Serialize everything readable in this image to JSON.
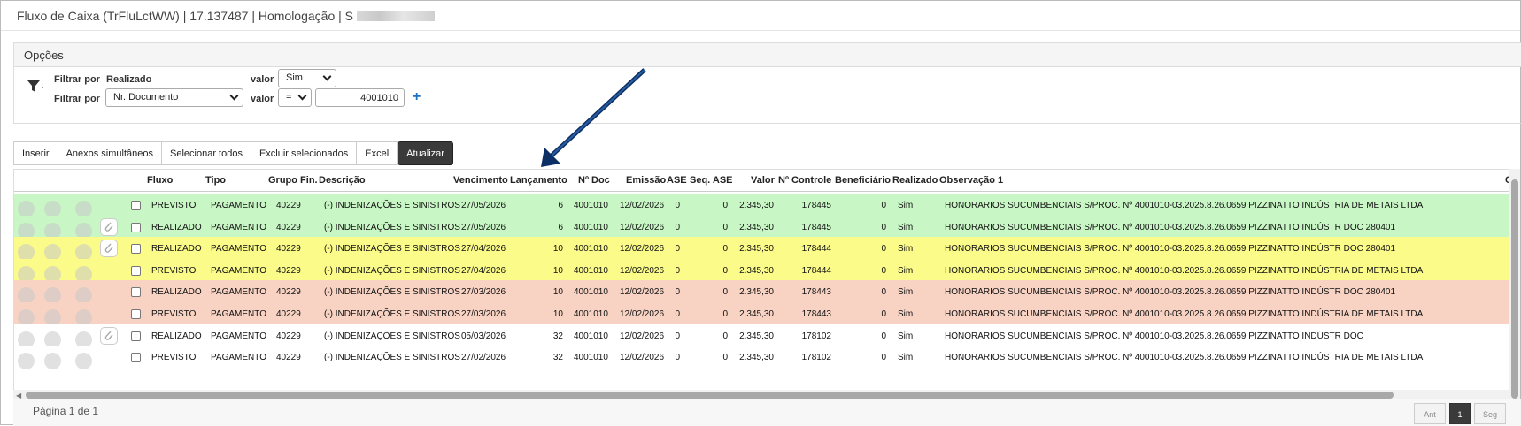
{
  "window": {
    "title": "Fluxo de Caixa (TrFluLctWW) | 17.137487 | Homologação | S"
  },
  "options": {
    "header": "Opções",
    "filters": [
      {
        "label": "Filtrar por",
        "field": "Realizado",
        "value_label": "valor",
        "value": "Sim"
      },
      {
        "label": "Filtrar por",
        "field": "Nr. Documento",
        "value_label": "valor",
        "operator": "=",
        "value": "4001010"
      }
    ],
    "add_filter_icon": "plus-icon"
  },
  "toolbar": {
    "insert": "Inserir",
    "annexes": "Anexos simultâneos",
    "select_all": "Selecionar todos",
    "delete_selected": "Excluir selecionados",
    "excel": "Excel",
    "refresh": "Atualizar"
  },
  "grid": {
    "columns": [
      "Fluxo",
      "Tipo",
      "Grupo Fin.",
      "Descrição",
      "Vencimento",
      "Lançamento",
      "Nº Doc",
      "Emissão",
      "ASE",
      "Seq. ASE",
      "Valor",
      "Nº Controle",
      "Beneficiário",
      "Realizado",
      "Observação 1",
      "C"
    ],
    "rows": [
      {
        "color": "#c8f7c5",
        "clip": false,
        "fluxo": "PREVISTO",
        "tipo": "PAGAMENTO",
        "grupo": "40229",
        "descricao": "(-) INDENIZAÇÕES E SINISTROS",
        "vencimento": "27/05/2026",
        "lancamento": "6",
        "doc": "4001010",
        "emissao": "12/02/2026",
        "ase": "0",
        "seq": "0",
        "valor": "2.345,30",
        "controle": "178445",
        "benef": "0",
        "realizado": "Sim",
        "obs": "HONORARIOS SUCUMBENCIAIS S/PROC. Nº 4001010-03.2025.8.26.0659 PIZZINATTO INDÚSTRIA DE METAIS LTDA"
      },
      {
        "color": "#c8f7c5",
        "clip": true,
        "fluxo": "REALIZADO",
        "tipo": "PAGAMENTO",
        "grupo": "40229",
        "descricao": "(-) INDENIZAÇÕES E SINISTROS",
        "vencimento": "27/05/2026",
        "lancamento": "6",
        "doc": "4001010",
        "emissao": "12/02/2026",
        "ase": "0",
        "seq": "0",
        "valor": "2.345,30",
        "controle": "178445",
        "benef": "0",
        "realizado": "Sim",
        "obs": "HONORARIOS SUCUMBENCIAIS S/PROC. Nº 4001010-03.2025.8.26.0659 PIZZINATTO INDÚSTR DOC 280401"
      },
      {
        "color": "#fbfb8a",
        "clip": true,
        "fluxo": "REALIZADO",
        "tipo": "PAGAMENTO",
        "grupo": "40229",
        "descricao": "(-) INDENIZAÇÕES E SINISTROS",
        "vencimento": "27/04/2026",
        "lancamento": "10",
        "doc": "4001010",
        "emissao": "12/02/2026",
        "ase": "0",
        "seq": "0",
        "valor": "2.345,30",
        "controle": "178444",
        "benef": "0",
        "realizado": "Sim",
        "obs": "HONORARIOS SUCUMBENCIAIS S/PROC. Nº 4001010-03.2025.8.26.0659 PIZZINATTO INDÚSTR DOC 280401"
      },
      {
        "color": "#fbfb8a",
        "clip": false,
        "fluxo": "PREVISTO",
        "tipo": "PAGAMENTO",
        "grupo": "40229",
        "descricao": "(-) INDENIZAÇÕES E SINISTROS",
        "vencimento": "27/04/2026",
        "lancamento": "10",
        "doc": "4001010",
        "emissao": "12/02/2026",
        "ase": "0",
        "seq": "0",
        "valor": "2.345,30",
        "controle": "178444",
        "benef": "0",
        "realizado": "Sim",
        "obs": "HONORARIOS SUCUMBENCIAIS S/PROC. Nº 4001010-03.2025.8.26.0659 PIZZINATTO INDÚSTRIA DE METAIS LTDA"
      },
      {
        "color": "#f8d3c4",
        "clip": false,
        "fluxo": "REALIZADO",
        "tipo": "PAGAMENTO",
        "grupo": "40229",
        "descricao": "(-) INDENIZAÇÕES E SINISTROS",
        "vencimento": "27/03/2026",
        "lancamento": "10",
        "doc": "4001010",
        "emissao": "12/02/2026",
        "ase": "0",
        "seq": "0",
        "valor": "2.345,30",
        "controle": "178443",
        "benef": "0",
        "realizado": "Sim",
        "obs": "HONORARIOS SUCUMBENCIAIS S/PROC. Nº 4001010-03.2025.8.26.0659 PIZZINATTO INDÚSTR DOC 280401"
      },
      {
        "color": "#f8d3c4",
        "clip": false,
        "fluxo": "PREVISTO",
        "tipo": "PAGAMENTO",
        "grupo": "40229",
        "descricao": "(-) INDENIZAÇÕES E SINISTROS",
        "vencimento": "27/03/2026",
        "lancamento": "10",
        "doc": "4001010",
        "emissao": "12/02/2026",
        "ase": "0",
        "seq": "0",
        "valor": "2.345,30",
        "controle": "178443",
        "benef": "0",
        "realizado": "Sim",
        "obs": "HONORARIOS SUCUMBENCIAIS S/PROC. Nº 4001010-03.2025.8.26.0659 PIZZINATTO INDÚSTRIA DE METAIS LTDA"
      },
      {
        "color": "#ffffff",
        "clip": true,
        "fluxo": "REALIZADO",
        "tipo": "PAGAMENTO",
        "grupo": "40229",
        "descricao": "(-) INDENIZAÇÕES E SINISTROS",
        "vencimento": "05/03/2026",
        "lancamento": "32",
        "doc": "4001010",
        "emissao": "12/02/2026",
        "ase": "0",
        "seq": "0",
        "valor": "2.345,30",
        "controle": "178102",
        "benef": "0",
        "realizado": "Sim",
        "obs": "HONORARIOS SUCUMBENCIAIS S/PROC. Nº 4001010-03.2025.8.26.0659 PIZZINATTO INDÚSTR DOC"
      },
      {
        "color": "#ffffff",
        "clip": false,
        "fluxo": "PREVISTO",
        "tipo": "PAGAMENTO",
        "grupo": "40229",
        "descricao": "(-) INDENIZAÇÕES E SINISTROS",
        "vencimento": "27/02/2026",
        "lancamento": "32",
        "doc": "4001010",
        "emissao": "12/02/2026",
        "ase": "0",
        "seq": "0",
        "valor": "2.345,30",
        "controle": "178102",
        "benef": "0",
        "realizado": "Sim",
        "obs": "HONORARIOS SUCUMBENCIAIS S/PROC. Nº 4001010-03.2025.8.26.0659 PIZZINATTO INDÚSTRIA DE METAIS LTDA"
      }
    ]
  },
  "pagination": {
    "info": "Página 1 de 1",
    "prev": "Ant",
    "current": "1",
    "next": "Seg"
  }
}
